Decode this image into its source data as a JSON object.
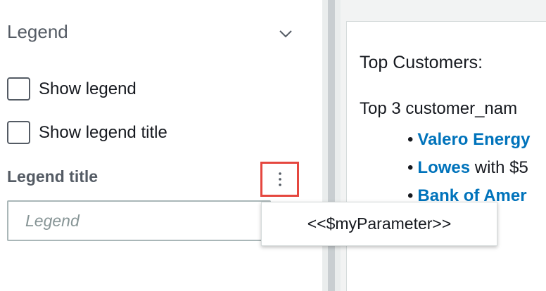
{
  "legend_panel": {
    "title": "Legend",
    "show_legend_label": "Show legend",
    "show_legend_title_label": "Show legend title",
    "legend_title_label": "Legend title",
    "legend_title_placeholder": "Legend",
    "menu_item": "<<$myParameter>>"
  },
  "visual": {
    "title": "Top Customers:",
    "subtitle": "Top 3 customer_nam",
    "items": [
      {
        "link": "Valero Energy",
        "rest": ""
      },
      {
        "link": "Lowes",
        "rest": " with $5"
      },
      {
        "link": "Bank of Amer",
        "rest": ""
      }
    ]
  },
  "colors": {
    "accent_link": "#0073bb",
    "highlight_border": "#e5473f"
  }
}
